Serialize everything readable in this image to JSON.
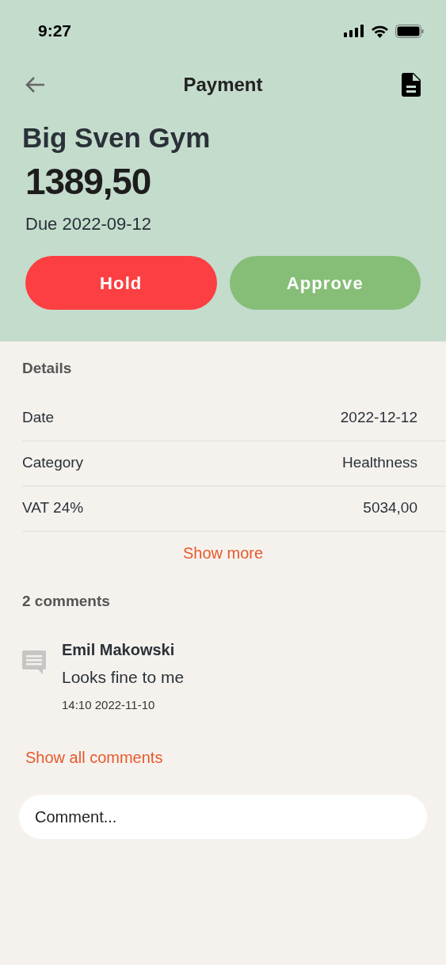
{
  "status_bar": {
    "time": "9:27"
  },
  "header": {
    "title": "Payment"
  },
  "payment": {
    "payee": "Big Sven Gym",
    "amount": "1389,50",
    "due": "Due 2022-09-12"
  },
  "actions": [
    {
      "label": "Hold",
      "kind": "hold"
    },
    {
      "label": "Approve",
      "kind": "approve"
    }
  ],
  "details": {
    "heading": "Details",
    "rows": [
      {
        "label": "Date",
        "value": "2022-12-12"
      },
      {
        "label": "Category",
        "value": "Healthness"
      },
      {
        "label": "VAT 24%",
        "value": "5034,00"
      }
    ],
    "show_more": "Show more"
  },
  "comments": {
    "heading": "2 comments",
    "items": [
      {
        "author": "Emil Makowski",
        "text": "Looks fine to me",
        "time": "14:10 2022-11-10"
      }
    ],
    "show_all": "Show all comments",
    "input": {
      "placeholder": "Comment..."
    }
  }
}
